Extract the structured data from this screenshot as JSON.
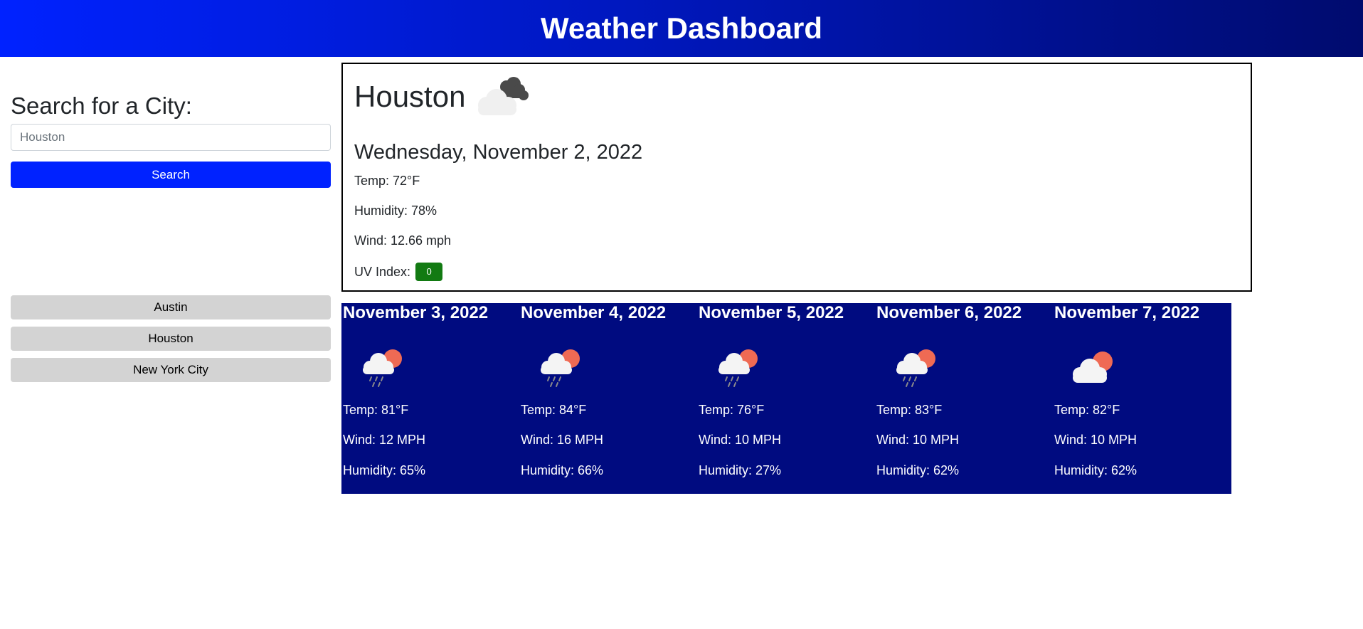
{
  "header": {
    "title": "Weather Dashboard"
  },
  "search": {
    "title": "Search for a City:",
    "input_value": "",
    "input_placeholder": "Houston",
    "button_label": "Search"
  },
  "history": [
    "Austin",
    "Houston",
    "New York City"
  ],
  "current": {
    "city": "Houston",
    "icon": "cloudy-icon",
    "date": "Wednesday, November 2, 2022",
    "temp": "Temp: 72°F",
    "humidity": "Humidity: 78%",
    "wind": "Wind: 12.66 mph",
    "uv_label": "UV Index:",
    "uv_value": "0",
    "uv_color": "#127a12"
  },
  "forecast": [
    {
      "date": "November 3, 2022",
      "icon": "sun-cloud-rain-icon",
      "temp": "Temp: 81°F",
      "wind": "Wind: 12 MPH",
      "humidity": "Humidity: 65%"
    },
    {
      "date": "November 4, 2022",
      "icon": "sun-cloud-rain-icon",
      "temp": "Temp: 84°F",
      "wind": "Wind: 16 MPH",
      "humidity": "Humidity: 66%"
    },
    {
      "date": "November 5, 2022",
      "icon": "sun-cloud-rain-icon",
      "temp": "Temp: 76°F",
      "wind": "Wind: 10 MPH",
      "humidity": "Humidity: 27%"
    },
    {
      "date": "November 6, 2022",
      "icon": "sun-cloud-rain-icon",
      "temp": "Temp: 83°F",
      "wind": "Wind: 10 MPH",
      "humidity": "Humidity: 62%"
    },
    {
      "date": "November 7, 2022",
      "icon": "sun-cloud-icon",
      "temp": "Temp: 82°F",
      "wind": "Wind: 10 MPH",
      "humidity": "Humidity: 62%"
    }
  ],
  "colors": {
    "header_start": "#0022ff",
    "header_end": "#000b6e",
    "search_button": "#0022ff",
    "history_button": "#d3d3d3",
    "forecast_bg": "#000b80",
    "uv_low": "#127a12"
  }
}
